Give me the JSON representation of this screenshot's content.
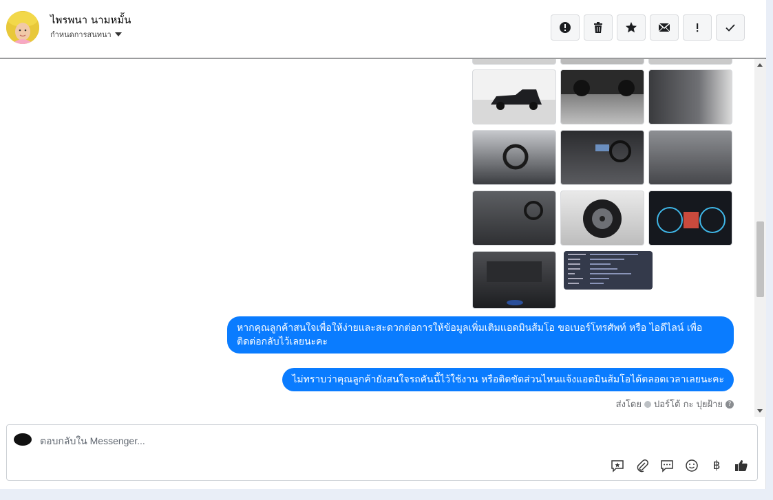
{
  "header": {
    "name": "ไพรพนา นามหมั้น",
    "assign_label": "กำหนดการสนทนา"
  },
  "actions": [
    {
      "name": "report-spam-icon",
      "label": "spam"
    },
    {
      "name": "trash-icon",
      "label": "delete"
    },
    {
      "name": "star-icon",
      "label": "star"
    },
    {
      "name": "mail-icon",
      "label": "mark unread"
    },
    {
      "name": "exclamation-icon",
      "label": "follow up"
    },
    {
      "name": "check-icon",
      "label": "done"
    }
  ],
  "messages": [
    {
      "text": "หากคุณลูกค้าสนใจเพื่อให้ง่ายและสะดวกต่อการให้ข้อมูลเพิ่มเติมแอดมินส้มโอ ขอเบอร์โทรศัพท์ หรือ ไอดีไลน์ เพื่อติดต่อกลับไว้เลยนะคะ"
    },
    {
      "text": "ไม่ทราบว่าคุณลูกค้ายังสนใจรถคันนี้ไว้ใช้งาน หรือติดขัดส่วนไหนแจ้งแอดมินส้มโอได้ตลอดเวลาเลยนะคะ"
    }
  ],
  "sent_by": {
    "prefix": "ส่งโดย",
    "agent": "ปอร์โต้ กะ ปุยฝ้าย"
  },
  "composer": {
    "placeholder": "ตอบกลับใน Messenger..."
  },
  "tools": [
    {
      "name": "saved-reply-icon"
    },
    {
      "name": "attachment-icon"
    },
    {
      "name": "faq-icon"
    },
    {
      "name": "emoji-icon"
    },
    {
      "name": "baht-icon",
      "glyph": "฿"
    },
    {
      "name": "thumbs-up-icon"
    }
  ],
  "colors": {
    "bubble": "#0a7cff",
    "header_border": "#1c1e21"
  }
}
